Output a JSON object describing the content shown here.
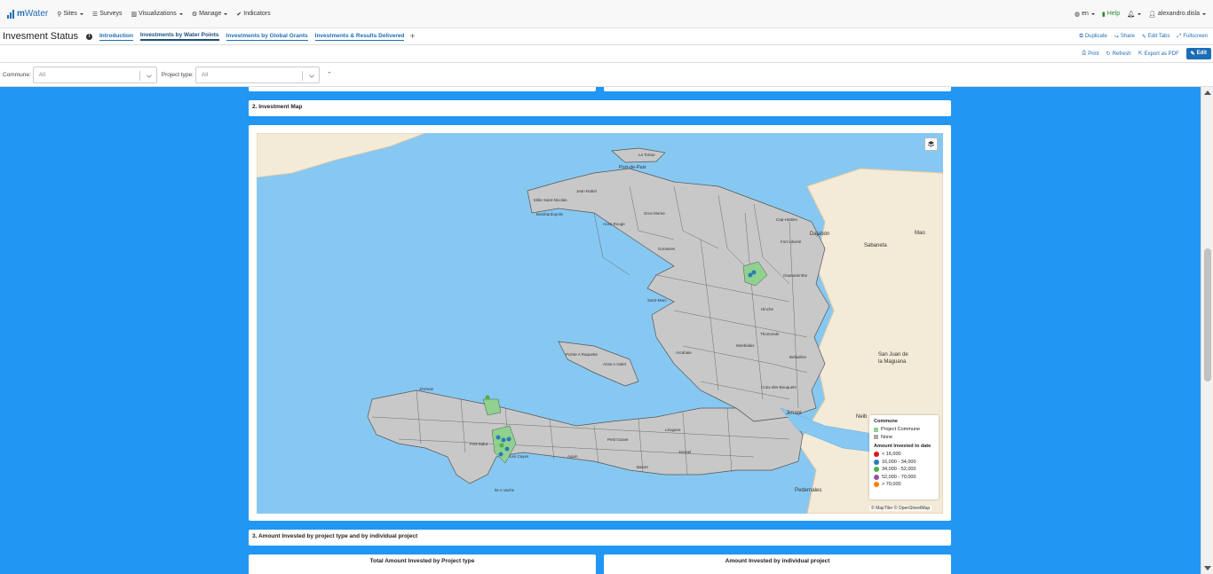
{
  "nav": {
    "logo_m": "m",
    "logo_water": "Water",
    "sites": "Sites",
    "surveys": "Surveys",
    "visualizations": "Visualizations",
    "manage": "Manage",
    "indicators": "Indicators",
    "language": "en",
    "help": "Help",
    "user": "alexandro.disla"
  },
  "tabs_row": {
    "page_title": "Invesment Status",
    "tabs": [
      "Introduction",
      "Investments by Water Points",
      "Investments by Global Grants",
      "Investments & Results Delivered"
    ],
    "actions": [
      "Duplicate",
      "Share",
      "Edit Tabs",
      "Fullscreen"
    ]
  },
  "action_row": {
    "print": "Print",
    "refresh": "Refresh",
    "export_pdf": "Export as PDF",
    "edit": "Edit"
  },
  "filters": {
    "commune_label": "Commune:",
    "commune_value": "All",
    "project_type_label": "Project type:",
    "project_type_value": "All"
  },
  "sections": {
    "investment_map_title": "2. Investment Map",
    "amount_title": "3. Amount Invested by project type and by individual project",
    "total_by_type": "Total Amount Invested by Project type",
    "by_individual": "Amount Invested by individual project"
  },
  "map": {
    "labels": {
      "tortue": "La Tortue",
      "port_de_paix": "Port-de-Paix",
      "jean_rabel": "Jean Rabel",
      "mole": "Môle Saint-Nicolas",
      "bombardopolis": "Bombardopolis",
      "anse_rouge": "Anse Rouge",
      "gros_morne": "Gros Morne",
      "gonaives": "Gonaïves",
      "saint_marc": "Saint-Marc",
      "mirebalais": "Mirebalais",
      "hinche": "Hinche",
      "arcahaie": "Arcahaie",
      "gonave": "Pointe A Raquette",
      "anse_a_galet": "Anse A Galet",
      "jeremie": "Jérémie",
      "les_cayes": "Les Cayes",
      "jacmel": "Jacmel",
      "leogane": "Léogane",
      "petit_goave": "Petit Goave",
      "cap_haitien": "Cap-Haïtien",
      "fort_liberte": "Fort-Liberté",
      "ouanaminthe": "Ouanaminthe",
      "thomonde": "Thomonde",
      "belladere": "Belladère",
      "croix_des_bouquets": "Croix-des-Bouquets",
      "port_salut": "Port-Salut",
      "aquin": "Aquin",
      "bainet": "Bainet",
      "dajabon": "Dajabón",
      "sabaneta": "Sabaneta",
      "mao": "Mao",
      "san_juan": "San Juan de la Maguana",
      "neiba": "Neib",
      "jimani": "Jimaní",
      "pedernales": "Pedernales",
      "ile_a_vache": "Ile A Vache"
    },
    "legend": {
      "commune_title": "Commune",
      "project_commune": "Project Commune",
      "none": "None",
      "amount_title": "Amount Invested to date",
      "bins": [
        "< 16,000",
        "16,000 - 34,000",
        "34,000 - 52,000",
        "52,000 - 70,000",
        "> 70,000"
      ],
      "bin_colors": [
        "#d7191c",
        "#2c7bb6",
        "#4daf4a",
        "#984ea3",
        "#ff7f00"
      ],
      "project_color": "#8fd18f",
      "none_color": "#aaaaaa"
    },
    "attribution": "© MapTiler © OpenStreetMap"
  }
}
